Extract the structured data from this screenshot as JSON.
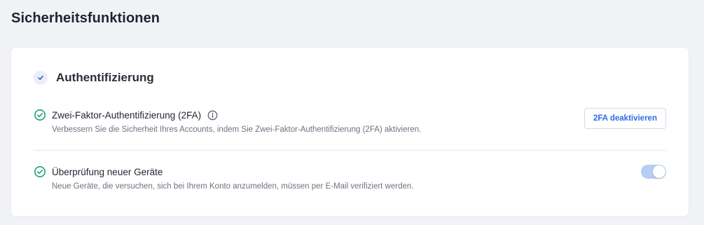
{
  "page": {
    "title": "Sicherheitsfunktionen"
  },
  "section": {
    "title": "Authentifizierung",
    "icon": "check-icon"
  },
  "features": [
    {
      "title": "Zwei-Faktor-Authentifizierung (2FA)",
      "description": "Verbessern Sie die Sicherheit Ihres Accounts, indem Sie Zwei-Faktor-Authentifizierung (2FA) aktivieren.",
      "status_icon": "check-circle-icon",
      "info_icon": "info-icon",
      "action_label": "2FA deaktivieren"
    },
    {
      "title": "Überprüfung neuer Geräte",
      "description": "Neue Geräte, die versuchen, sich bei Ihrem Konto anzumelden, müssen per E-Mail verifiziert werden.",
      "status_icon": "check-circle-icon",
      "toggle_on": true
    }
  ],
  "colors": {
    "background": "#f0f2f6",
    "card": "#ffffff",
    "success": "#1aa37a",
    "accent": "#2d6be4",
    "toggle_track": "#b6cdf4"
  }
}
